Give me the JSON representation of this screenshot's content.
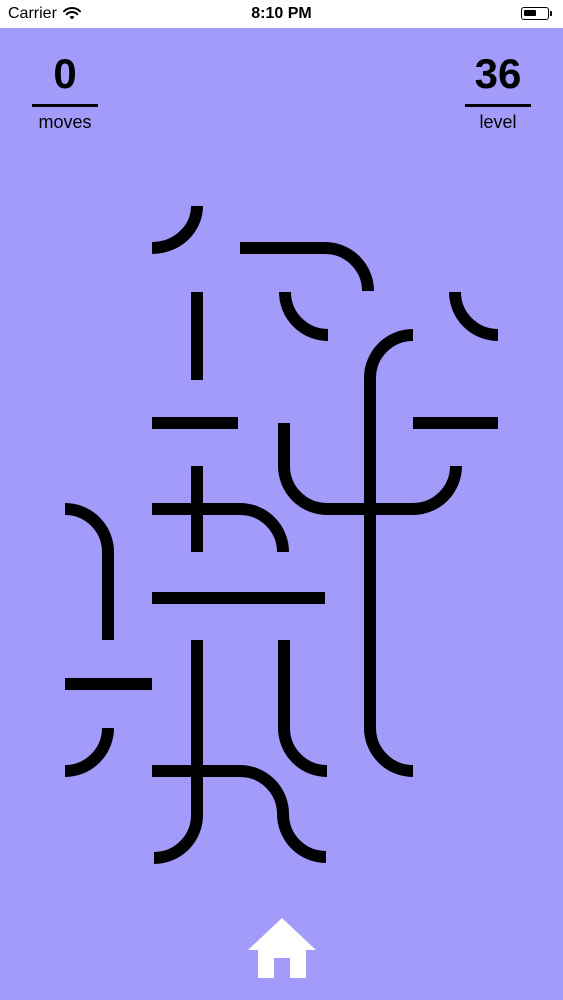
{
  "status_bar": {
    "carrier": "Carrier",
    "time": "8:10 PM"
  },
  "hud": {
    "moves_value": "0",
    "moves_label": "moves",
    "level_value": "36",
    "level_label": "level"
  },
  "nav": {
    "home_icon": "home-icon"
  },
  "colors": {
    "background": "#a39bfa",
    "ink": "#000000",
    "status_bar": "#ffffff",
    "home_icon": "#ffffff"
  }
}
